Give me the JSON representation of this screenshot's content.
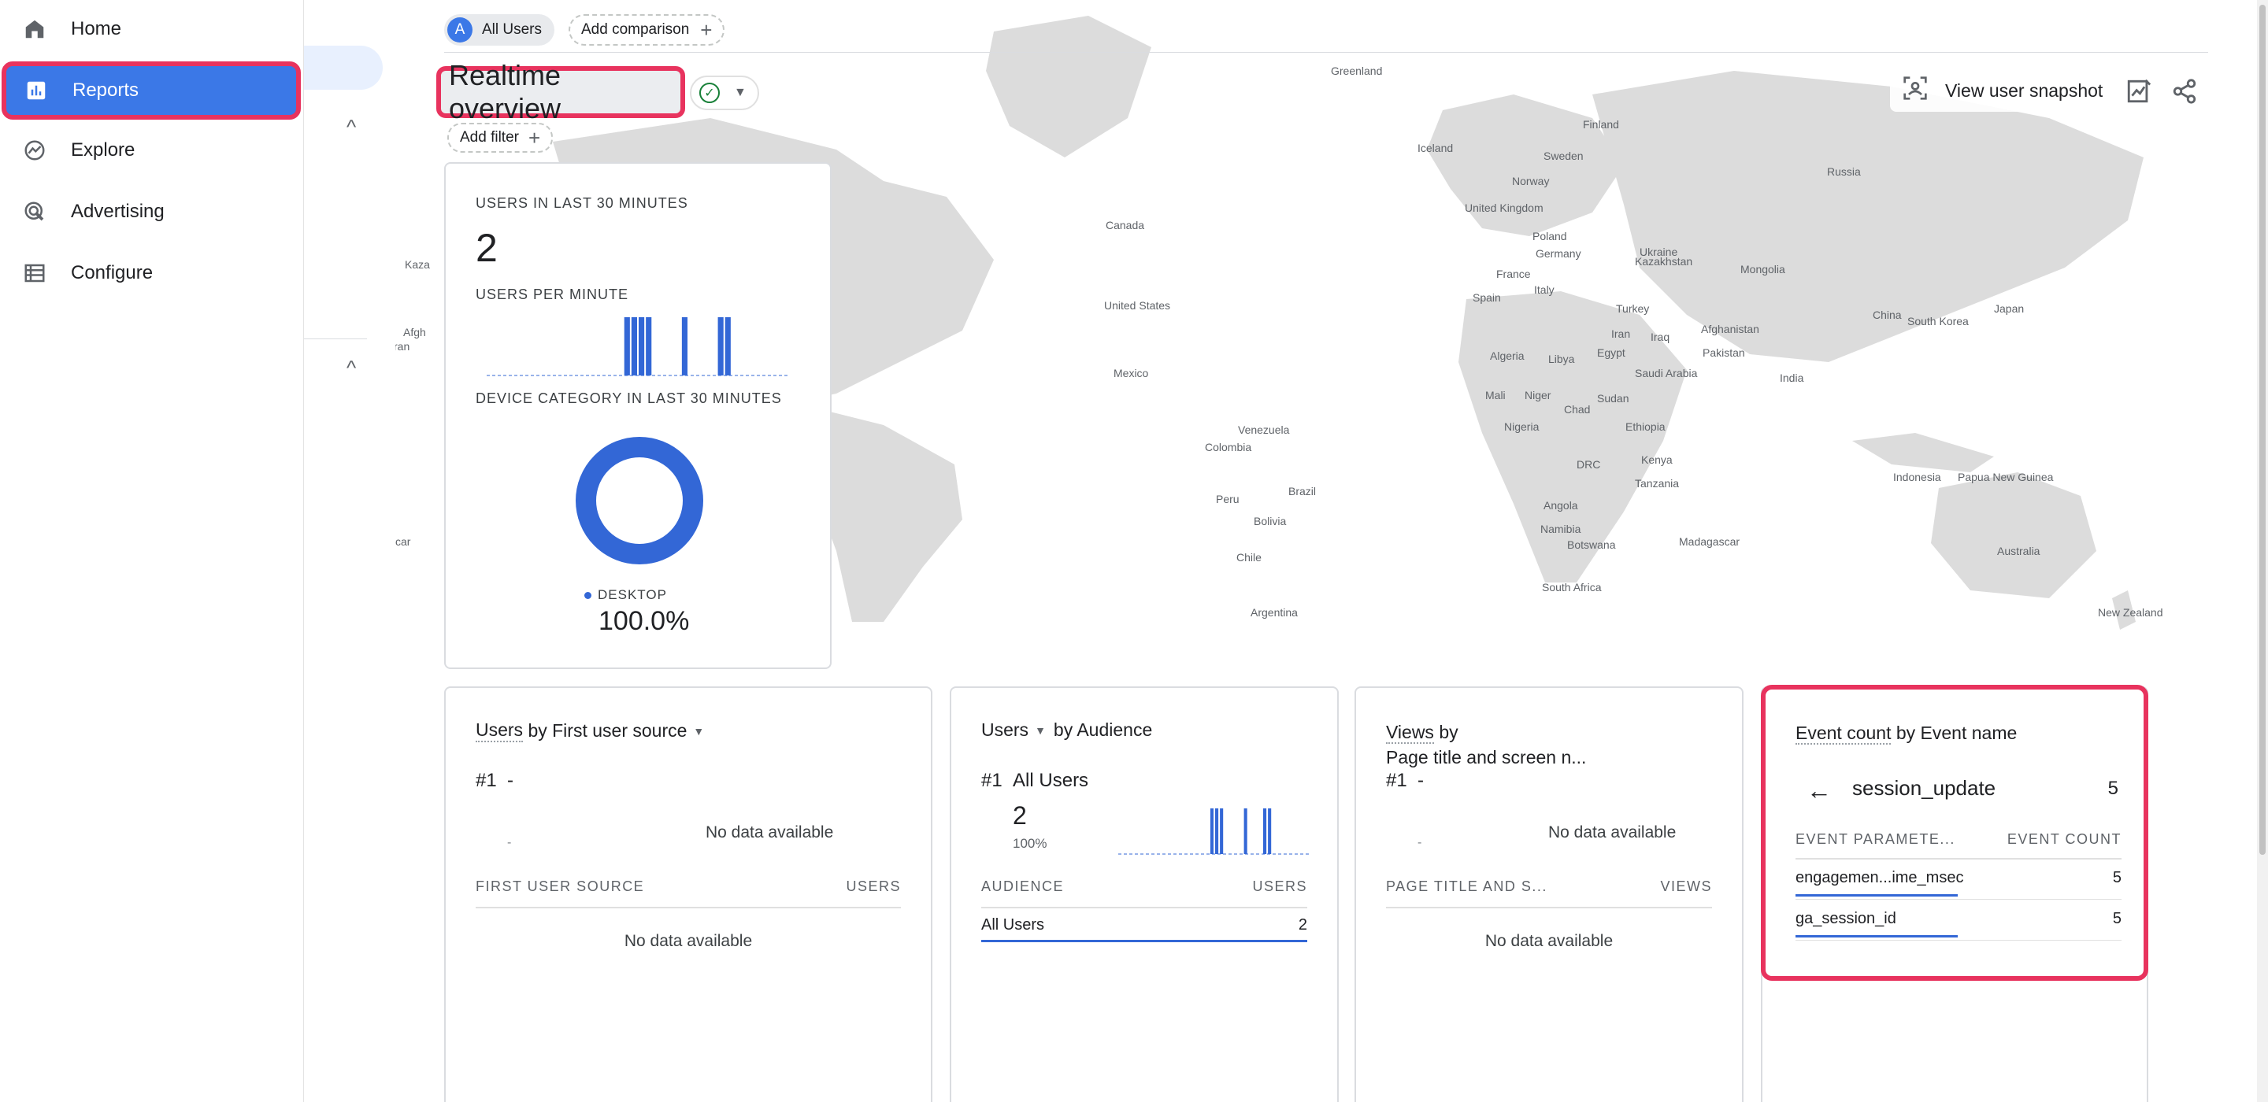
{
  "sidebar": {
    "items": [
      {
        "label": "Home",
        "icon": "home-icon"
      },
      {
        "label": "Reports",
        "icon": "reports-icon"
      },
      {
        "label": "Explore",
        "icon": "explore-icon"
      },
      {
        "label": "Advertising",
        "icon": "advertising-icon"
      },
      {
        "label": "Configure",
        "icon": "configure-icon"
      }
    ]
  },
  "header": {
    "segment_letter": "A",
    "segment_label": "All Users",
    "add_comparison": "Add comparison",
    "title": "Realtime overview",
    "add_filter": "Add filter",
    "snapshot_label": "View user snapshot"
  },
  "map_labels": [
    "Greenland",
    "Finland",
    "Iceland",
    "Sweden",
    "Norway",
    "Russia",
    "United Kingdom",
    "Poland",
    "Germany",
    "Ukraine",
    "Kazakhstan",
    "Mongolia",
    "France",
    "Italy",
    "Spain",
    "Turkey",
    "China",
    "South Korea",
    "Japan",
    "Iraq",
    "Afghanistan",
    "Iran",
    "Pakistan",
    "India",
    "Canada",
    "United States",
    "Mexico",
    "Algeria",
    "Libya",
    "Egypt",
    "Saudi Arabia",
    "Mali",
    "Niger",
    "Chad",
    "Sudan",
    "Nigeria",
    "Ethiopia",
    "DRC",
    "Kenya",
    "Tanzania",
    "Angola",
    "Namibia",
    "Botswana",
    "Madagascar",
    "South Africa",
    "Venezuela",
    "Colombia",
    "Peru",
    "Brazil",
    "Bolivia",
    "Chile",
    "Argentina",
    "Indonesia",
    "Papua New Guinea",
    "Australia",
    "New Zealand",
    "Kaza",
    "Afgh",
    "ran",
    "car"
  ],
  "card_users": {
    "users_30_label": "USERS IN LAST 30 MINUTES",
    "users_30_value": "2",
    "per_minute_label": "USERS PER MINUTE",
    "per_minute_values": [
      0,
      0,
      0,
      0,
      0,
      0,
      0,
      0,
      0,
      0,
      0,
      0,
      0,
      0,
      0,
      0,
      0,
      0,
      0,
      1,
      1,
      1,
      1,
      0,
      0,
      0,
      0,
      1,
      0,
      0,
      0,
      0,
      1,
      1,
      0,
      0,
      0,
      0,
      0,
      0,
      0,
      0
    ],
    "device_label": "DEVICE CATEGORY IN LAST 30 MINUTES",
    "device_name": "DESKTOP",
    "device_pct": "100.0%",
    "device_share": 1.0,
    "accent": "#3367d6"
  },
  "card_source": {
    "title_a": "Users",
    "title_b": "by First user source",
    "rank": "#1",
    "rank_value": "-",
    "spark_dash": "-",
    "no_data": "No data available",
    "col1": "FIRST USER SOURCE",
    "col2": "USERS",
    "table_no_data": "No data available"
  },
  "card_audience": {
    "title_a": "Users",
    "title_b": "by Audience",
    "rank": "#1",
    "rank_value": "All Users",
    "value": "2",
    "pct": "100%",
    "spark_values": [
      0,
      0,
      0,
      0,
      0,
      0,
      0,
      0,
      0,
      0,
      0,
      0,
      0,
      0,
      0,
      0,
      0,
      0,
      0,
      1,
      1,
      1,
      0,
      0,
      0,
      0,
      1,
      0,
      0,
      0,
      1,
      1,
      0,
      0,
      0,
      0,
      0,
      0,
      0,
      0
    ],
    "col1": "AUDIENCE",
    "col2": "USERS",
    "rows": [
      {
        "name": "All Users",
        "value": "2",
        "share": 1.0
      }
    ]
  },
  "card_views": {
    "title_a": "Views",
    "title_b": "by",
    "title_c": "Page title and screen n...",
    "rank": "#1",
    "rank_value": "-",
    "spark_dash": "-",
    "no_data": "No data available",
    "col1": "PAGE TITLE AND S...",
    "col2": "VIEWS",
    "table_no_data": "No data available"
  },
  "card_events": {
    "title_a": "Event count",
    "title_b": "by Event name",
    "event_name": "session_update",
    "event_total": "5",
    "col1": "EVENT PARAMETE...",
    "col2": "EVENT COUNT",
    "rows": [
      {
        "name": "engagemen...ime_msec",
        "value": "5",
        "share": 1.0
      },
      {
        "name": "ga_session_id",
        "value": "5",
        "share": 1.0
      }
    ]
  }
}
